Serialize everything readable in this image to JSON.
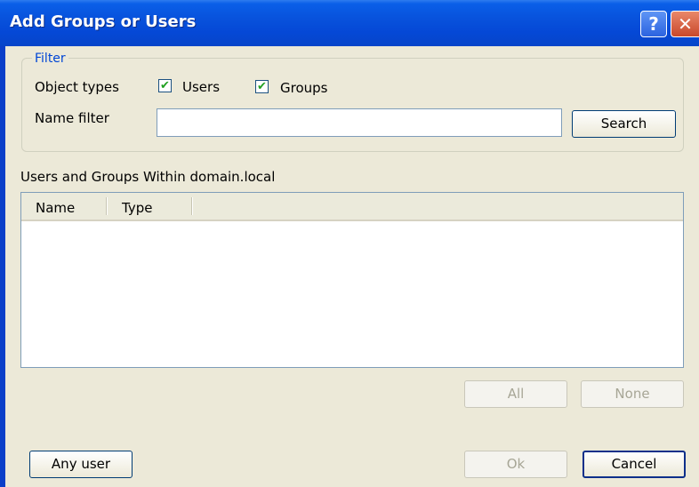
{
  "window": {
    "title": "Add Groups or Users",
    "help_glyph": "?",
    "close_glyph": "✕"
  },
  "filter": {
    "legend": "Filter",
    "object_types_label": "Object types",
    "users_label": "Users",
    "users_checked": true,
    "groups_label": "Groups",
    "groups_checked": true,
    "name_filter_label": "Name filter",
    "name_filter_value": "",
    "search_button": "Search"
  },
  "list": {
    "caption": "Users and Groups Within domain.local",
    "columns": [
      "Name",
      "Type"
    ],
    "rows": []
  },
  "selection": {
    "all_button": "All",
    "none_button": "None"
  },
  "footer": {
    "any_user_button": "Any user",
    "ok_button": "Ok",
    "cancel_button": "Cancel"
  },
  "colors": {
    "titlebar": "#0852dc",
    "dialog_bg": "#ece9d8",
    "legend_text": "#0046d5",
    "checkmark": "#21a121"
  },
  "icons": [
    "help-icon",
    "close-icon",
    "checkbox-check-icon"
  ]
}
